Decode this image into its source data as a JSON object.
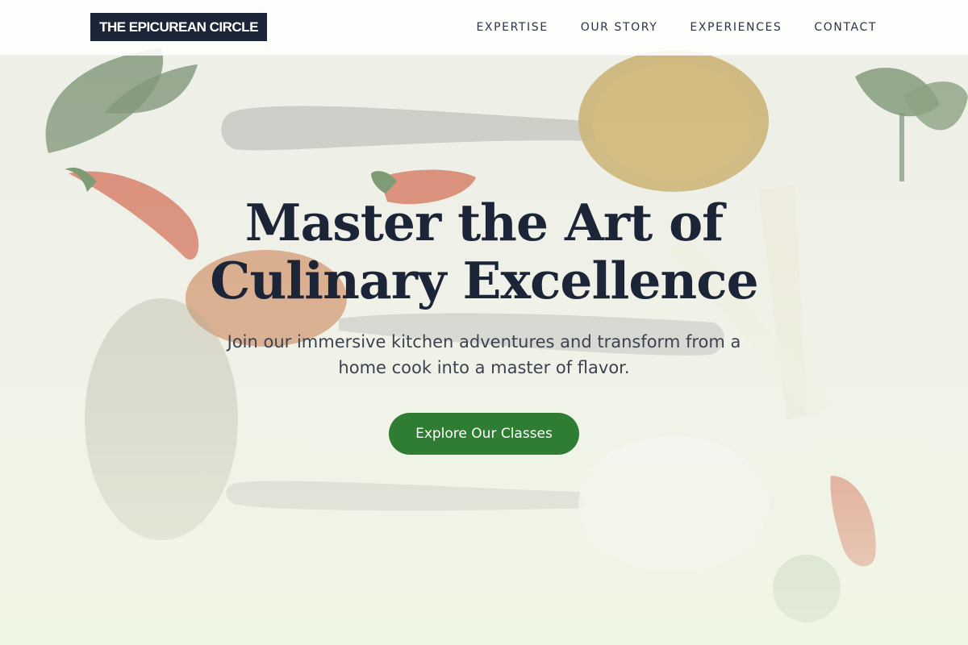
{
  "header": {
    "logo_text": "THE EPICUREAN CIRCLE",
    "nav": [
      {
        "label": "EXPERTISE"
      },
      {
        "label": "OUR STORY"
      },
      {
        "label": "EXPERIENCES"
      },
      {
        "label": "CONTACT"
      }
    ]
  },
  "hero": {
    "title_line1": "Master the Art of",
    "title_line2": "Culinary Excellence",
    "subtitle": "Join our immersive kitchen adventures and transform from a home cook into a master of flavor.",
    "cta_label": "Explore Our Classes"
  },
  "colors": {
    "primary_dark": "#1c2538",
    "accent_green": "#2e7d32"
  }
}
